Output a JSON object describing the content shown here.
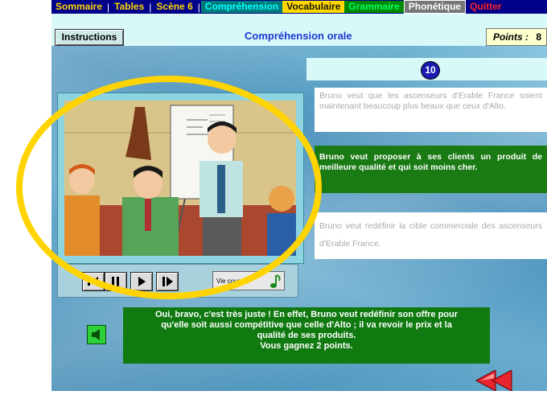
{
  "menu": {
    "items": [
      {
        "label": "Sommaire"
      },
      {
        "label": "Tables"
      },
      {
        "label": "Scène 6"
      },
      {
        "label": "Compréhension"
      },
      {
        "label": "Vocabulaire"
      },
      {
        "label": "Grammaire"
      },
      {
        "label": "Phonétique"
      },
      {
        "label": "Quitter"
      }
    ],
    "separator": "|"
  },
  "header": {
    "instructions_label": "Instructions",
    "title": "Compréhension orale",
    "points_label": "Points :",
    "points_value": "8"
  },
  "question": {
    "number": "10"
  },
  "answers": [
    {
      "text": "Bruno veut que les ascenseurs d'Erable France soient maintenant beaucoup plus beaux que ceux d'Alto.",
      "state": "unselected"
    },
    {
      "text": "Bruno veut proposer à ses clients un produit de meilleure qualité et qui soit moins cher.",
      "state": "selected"
    },
    {
      "text": "Bruno veut redéfinir la cible commerciale des ascenseurs d'Erable France.",
      "state": "unselected"
    }
  ],
  "player": {
    "speed_label": "Vie cours",
    "icons": [
      "rewind-icon",
      "pause-icon",
      "play-icon",
      "step-forward-icon",
      "music-note-icon"
    ]
  },
  "feedback": {
    "lines": [
      "Oui, bravo, c'est très juste ! En effet, Bruno veut redéfinir son offre pour",
      "qu'elle soit aussi compétitive que celle d'Alto ; il  va revoir le prix et la",
      "qualité de ses produits.",
      "Vous gagnez 2 points."
    ]
  },
  "colors": {
    "menu_bg": "#00008a",
    "accent_blue": "#1a37d0",
    "correct_green": "#107a10",
    "highlight_yellow": "#ffd400"
  }
}
